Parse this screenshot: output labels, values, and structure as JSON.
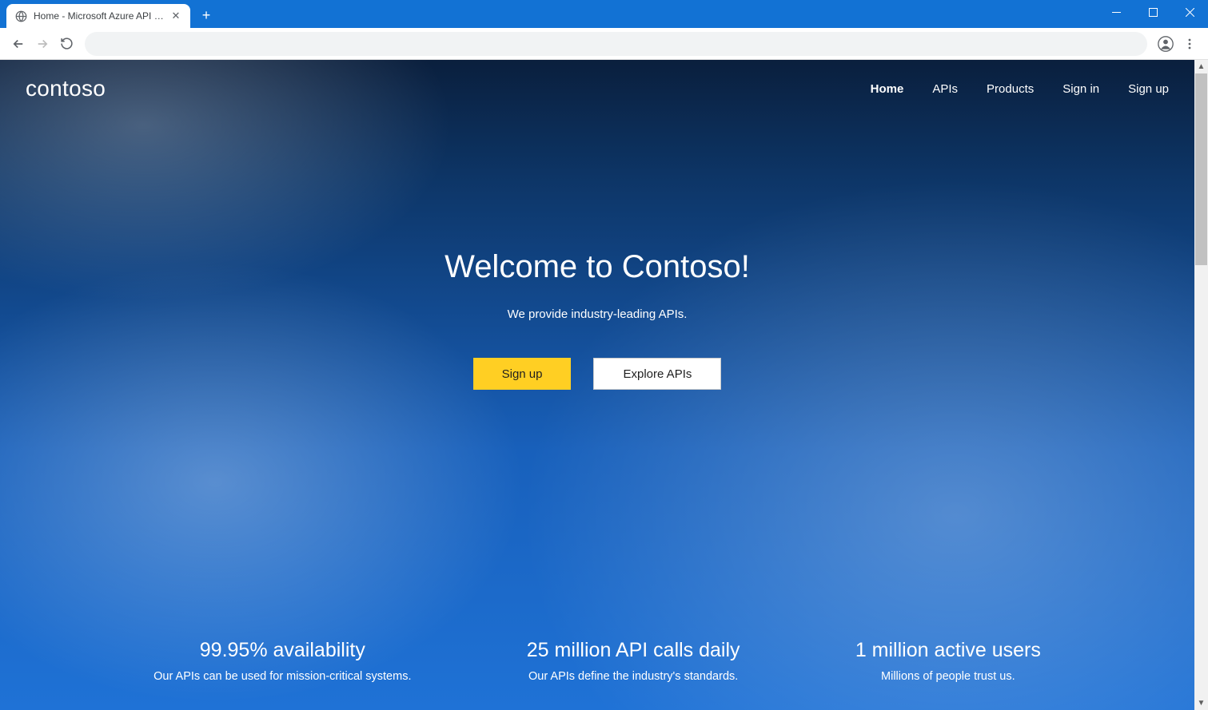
{
  "browser": {
    "tab_title": "Home - Microsoft Azure API Man"
  },
  "page": {
    "brand": "contoso",
    "nav": {
      "home": "Home",
      "apis": "APIs",
      "products": "Products",
      "signin": "Sign in",
      "signup": "Sign up"
    },
    "hero": {
      "title": "Welcome to Contoso!",
      "subtitle": "We provide industry-leading APIs.",
      "cta_signup": "Sign up",
      "cta_explore": "Explore APIs"
    },
    "stats": [
      {
        "headline": "99.95% availability",
        "sub": "Our APIs can be used for mission-critical systems."
      },
      {
        "headline": "25 million API calls daily",
        "sub": "Our APIs define the industry's standards."
      },
      {
        "headline": "1 million active users",
        "sub": "Millions of people trust us."
      }
    ]
  }
}
